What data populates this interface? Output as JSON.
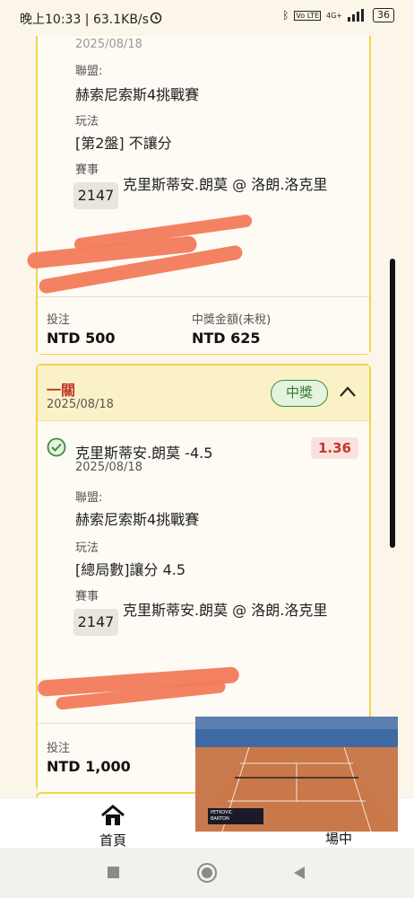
{
  "status_bar": {
    "time_speed": "晚上10:33 | 63.1KB/s",
    "network": "4G+",
    "battery": "36"
  },
  "card1": {
    "date_partial": "2025/08/18",
    "league_label": "聯盟:",
    "league": "赫索尼索斯4挑戰賽",
    "play_label": "玩法",
    "play": "[第2盤] 不讓分",
    "event_label": "賽事",
    "event_no": "2147",
    "event_name": "克里斯蒂安.朗莫 @ 洛朗.洛克里",
    "stake_label": "投注",
    "stake": "NTD 500",
    "payout_label": "中獎金額(未稅)",
    "payout": "NTD 625"
  },
  "card2": {
    "type": "一關",
    "date": "2025/08/18",
    "status": "中獎",
    "selection": "克里斯蒂安.朗莫 -4.5",
    "selection_date": "2025/08/18",
    "odds": "1.36",
    "league_label": "聯盟:",
    "league": "赫索尼索斯4挑戰賽",
    "play_label": "玩法",
    "play": "[總局數]讓分 4.5",
    "event_label": "賽事",
    "event_no": "2147",
    "event_name": "克里斯蒂安.朗莫 @ 洛朗.洛克里",
    "stake_label": "投注",
    "stake": "NTD 1,000"
  },
  "bottom_nav": {
    "home": "首頁",
    "live": "場中"
  },
  "video": {
    "player1": "PETKOVIC",
    "player2": "BARTON"
  },
  "colors": {
    "accent_yellow": "#f2d34a",
    "win_green": "#3b8c3b",
    "odds_red": "#c0392b",
    "type_red": "#c0392b"
  }
}
